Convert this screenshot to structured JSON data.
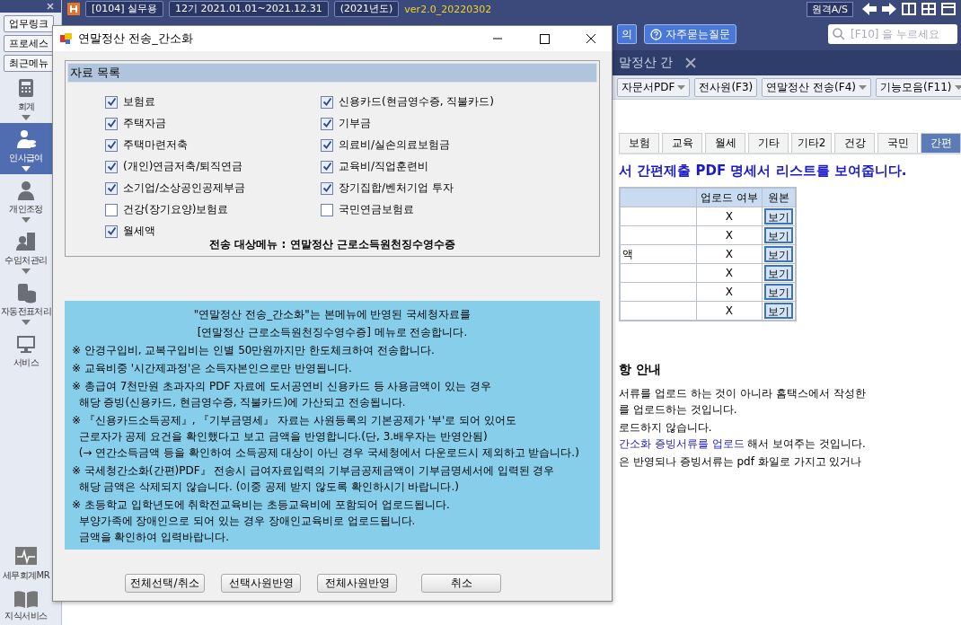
{
  "top_bar": {
    "company": "[0104] 실무용",
    "period": "12기 2021.01.01~2021.12.31",
    "year": "(2021년도)",
    "version": "ver2.0_20220302",
    "remote_button": "원격A/S"
  },
  "sidebar": {
    "quick_buttons": [
      "업무링크",
      "프로세스",
      "최근메뉴"
    ],
    "items": [
      {
        "label": "회계",
        "selected": false,
        "expandable": true
      },
      {
        "label": "인사급여",
        "selected": true,
        "expandable": true
      },
      {
        "label": "개인조정",
        "selected": false,
        "expandable": true
      },
      {
        "label": "수임처관리",
        "selected": false,
        "expandable": true
      },
      {
        "label": "자동전표처리",
        "selected": false,
        "expandable": true
      },
      {
        "label": "서비스",
        "selected": false,
        "expandable": false
      }
    ],
    "bottom_items": [
      "세무회계MR",
      "지식서비스"
    ]
  },
  "toolbar": {
    "partial_button": "의",
    "faq_button": "자주묻는질문",
    "search": {
      "placeholder": "[F10] 을 누르세요"
    }
  },
  "doc_tab": {
    "label": "말정산 간"
  },
  "action_buttons": [
    {
      "label": "자문서PDF",
      "dropdown": true
    },
    {
      "label": "전사원(F3)",
      "dropdown": false
    },
    {
      "label": "연말정산 전송(F4)",
      "dropdown": true
    },
    {
      "label": "기능모음(F11)",
      "dropdown": true
    }
  ],
  "category_tabs": [
    {
      "label": "보험",
      "selected": false
    },
    {
      "label": "교육",
      "selected": false
    },
    {
      "label": "월세",
      "selected": false
    },
    {
      "label": "기타",
      "selected": false
    },
    {
      "label": "기타2",
      "selected": false
    },
    {
      "label": "건강",
      "selected": false
    },
    {
      "label": "국민",
      "selected": false
    },
    {
      "label": "간편",
      "selected": true
    }
  ],
  "heading": "서 간편제출 PDF 명세서 리스트를 보여줍니다.",
  "table": {
    "columns": [
      "업로드 여부",
      "원본"
    ],
    "rows": [
      {
        "upload": "X",
        "view_button": "보기"
      },
      {
        "upload": "X",
        "view_button": "보기"
      },
      {
        "column_1": "액",
        "upload": "X",
        "view_button": "보기"
      },
      {
        "upload": "X",
        "view_button": "보기"
      },
      {
        "upload": "X",
        "view_button": "보기"
      },
      {
        "upload": "X",
        "view_button": "보기"
      }
    ]
  },
  "notice": {
    "title": "항 안내",
    "lines": [
      {
        "text": "서류를 업로드 하는 것이 아니라 홈택스에서 작성한"
      },
      {
        "text": " 를 업로드하는 것입니다."
      },
      {
        "text": "로드하지 않습니다."
      },
      {
        "link": "간소화 증빙서류를 업로드",
        "text": " 해서 보여주는 것입니다."
      },
      {
        "text": "은 반영되나 증빙서류는 pdf 화일로 가지고 있거나"
      }
    ]
  },
  "dialog": {
    "title": "연말정산 전송_간소화",
    "group_title": "자료 목록",
    "items": [
      {
        "label": "보험료",
        "checked": true
      },
      {
        "label": "신용카드(현금영수증, 직불카드)",
        "checked": true
      },
      {
        "label": "주택자금",
        "checked": true
      },
      {
        "label": "기부금",
        "checked": true
      },
      {
        "label": "주택마련저축",
        "checked": true
      },
      {
        "label": "의료비/실손의료보험금",
        "checked": true
      },
      {
        "label": "(개인)연금저축/퇴직연금",
        "checked": true
      },
      {
        "label": "교육비/직업훈련비",
        "checked": true
      },
      {
        "label": "소기업/소상공인공제부금",
        "checked": true
      },
      {
        "label": "장기집합/벤처기업 투자",
        "checked": true
      },
      {
        "label": "건강(장기요양)보험료",
        "checked": false
      },
      {
        "label": "국민연금보험료",
        "checked": false
      },
      {
        "label": "월세액",
        "checked": true
      }
    ],
    "target_menu": "전송 대상메뉴 : 연말정산 근로소득원천징수영수증",
    "info": [
      {
        "text": "\"연말정산 전송_간소화\"는 본메뉴에 반영된 국세청자료를",
        "centered": true
      },
      {
        "text": "[연말정산 근로소득원천징수영수증] 메뉴로 전송합니다.",
        "centered": true
      },
      {
        "text": "※ 안경구입비, 교복구입비는 인별 50만원까지만 한도체크하여 전송합니다.",
        "centered": false
      },
      {
        "text": "※ 교육비중 '시간제과정'은 소득자본인으로만 반영됩니다.",
        "centered": false
      },
      {
        "text": "※ 총급여 7천만원 초과자의 PDF 자료에 도서공연비 신용카드 등 사용금액이 있는 경우",
        "centered": false
      },
      {
        "text": "  해당 증빙(신용카드, 현금영수증, 직불카드)에 가산되고 전송됩니다.",
        "centered": false
      },
      {
        "text": "※ 『신용카드소득공제』, 『기부금명세』 자료는 사원등록의 기본공제가 '부'로 되어 있어도",
        "centered": false
      },
      {
        "text": "  근로자가 공제 요건을 확인했다고 보고 금액을 반영합니다.(단, 3.배우자는 반영안됨)",
        "centered": false
      },
      {
        "text": "  (→ 연간소득금액 등을 확인하여 소득공제 대상이 아닌 경우 국세청에서 다운로드시 제외하고 받습니다.)",
        "centered": false
      },
      {
        "text": "※ 국세청간소화(간편)PDF』 전송시 급여자료입력의 기부금공제금액이 기부금명세서에 입력된 경우",
        "centered": false
      },
      {
        "text": "  해당 금액은 삭제되지 않습니다. (이중 공제 받지 않도록 확인하시기 바랍니다.)",
        "centered": false
      },
      {
        "text": "※ 초등학교 입학년도에 취학전교육비는 초등교육비에 포함되어 업로드됩니다.",
        "centered": false
      },
      {
        "text": "  부양가족에 장애인으로 되어 있는 경우 장애인교육비로 업로드됩니다.",
        "centered": false
      },
      {
        "text": "  금액을 확인하여 입력바랍니다.",
        "centered": false
      }
    ],
    "buttons": [
      "전체선택/취소",
      "선택사원반영",
      "전체사원반영",
      "취소"
    ]
  }
}
